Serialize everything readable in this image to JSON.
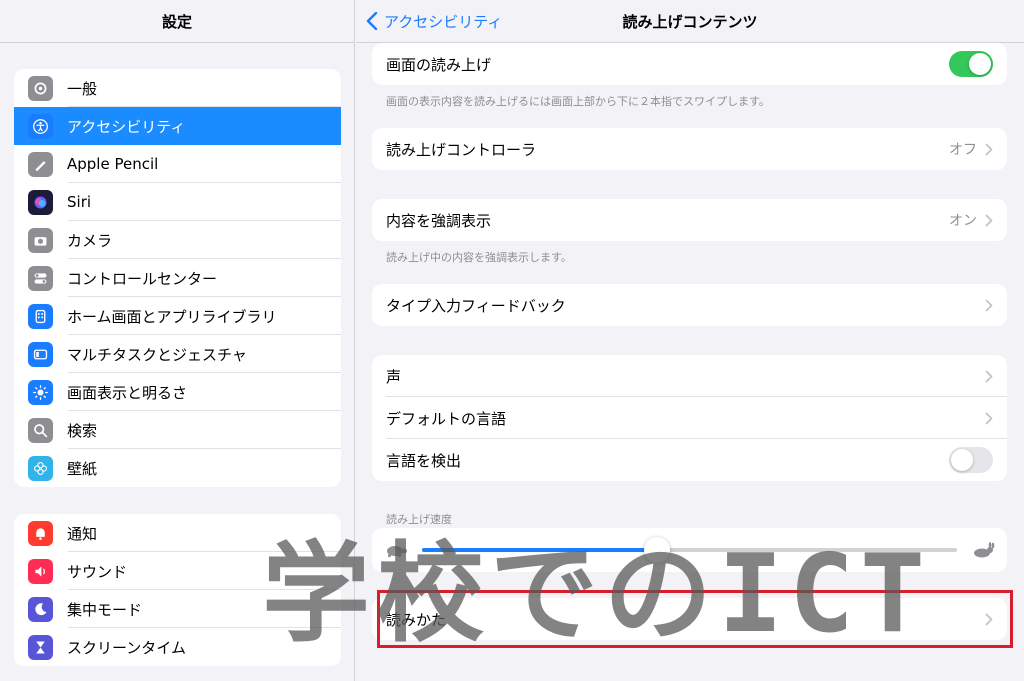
{
  "sidebar": {
    "title": "設定",
    "group1": [
      {
        "label": "一般",
        "icon": "gear-icon",
        "color": "#8e8e93"
      },
      {
        "label": "アクセシビリティ",
        "icon": "accessibility-icon",
        "color": "#1a7cff",
        "active": true
      },
      {
        "label": "Apple Pencil",
        "icon": "pencil-icon",
        "color": "#8e8e93"
      },
      {
        "label": "Siri",
        "icon": "siri-icon",
        "color": "#1c1c3a"
      },
      {
        "label": "カメラ",
        "icon": "camera-icon",
        "color": "#8e8e93"
      },
      {
        "label": "コントロールセンター",
        "icon": "control-center-icon",
        "color": "#8e8e93"
      },
      {
        "label": "ホーム画面とアプリライブラリ",
        "icon": "home-screen-icon",
        "color": "#1a7cff"
      },
      {
        "label": "マルチタスクとジェスチャ",
        "icon": "multitask-icon",
        "color": "#1a7cff"
      },
      {
        "label": "画面表示と明るさ",
        "icon": "brightness-icon",
        "color": "#1a7cff"
      },
      {
        "label": "検索",
        "icon": "search-icon",
        "color": "#8e8e93"
      },
      {
        "label": "壁紙",
        "icon": "wallpaper-icon",
        "color": "#2fb3e8"
      }
    ],
    "group2": [
      {
        "label": "通知",
        "icon": "notification-icon",
        "color": "#ff3b30"
      },
      {
        "label": "サウンド",
        "icon": "sound-icon",
        "color": "#ff2d55"
      },
      {
        "label": "集中モード",
        "icon": "moon-icon",
        "color": "#5856d6"
      },
      {
        "label": "スクリーンタイム",
        "icon": "hourglass-icon",
        "color": "#5856d6"
      }
    ]
  },
  "topbar": {
    "back_label": "アクセシビリティ",
    "title": "読み上げコンテンツ"
  },
  "main": {
    "speak_screen": {
      "label": "画面の読み上げ",
      "on": true
    },
    "speak_screen_note": "画面の表示内容を読み上げるには画面上部から下に２本指でスワイプします。",
    "speech_controller": {
      "label": "読み上げコントローラ",
      "value": "オフ"
    },
    "highlight_content": {
      "label": "内容を強調表示",
      "value": "オン"
    },
    "highlight_note": "読み上げ中の内容を強調表示します。",
    "typing_feedback": {
      "label": "タイプ入力フィードバック"
    },
    "voices": {
      "label": "声"
    },
    "default_language": {
      "label": "デフォルトの言語"
    },
    "detect_language": {
      "label": "言語を検出",
      "on": false
    },
    "rate_section": "読み上げ速度",
    "speaking_rate": 0.44,
    "pronunciations": {
      "label": "読みかた"
    }
  },
  "overlay": {
    "watermark": "学校でのICT",
    "highlight_color": "#d61f2b"
  }
}
